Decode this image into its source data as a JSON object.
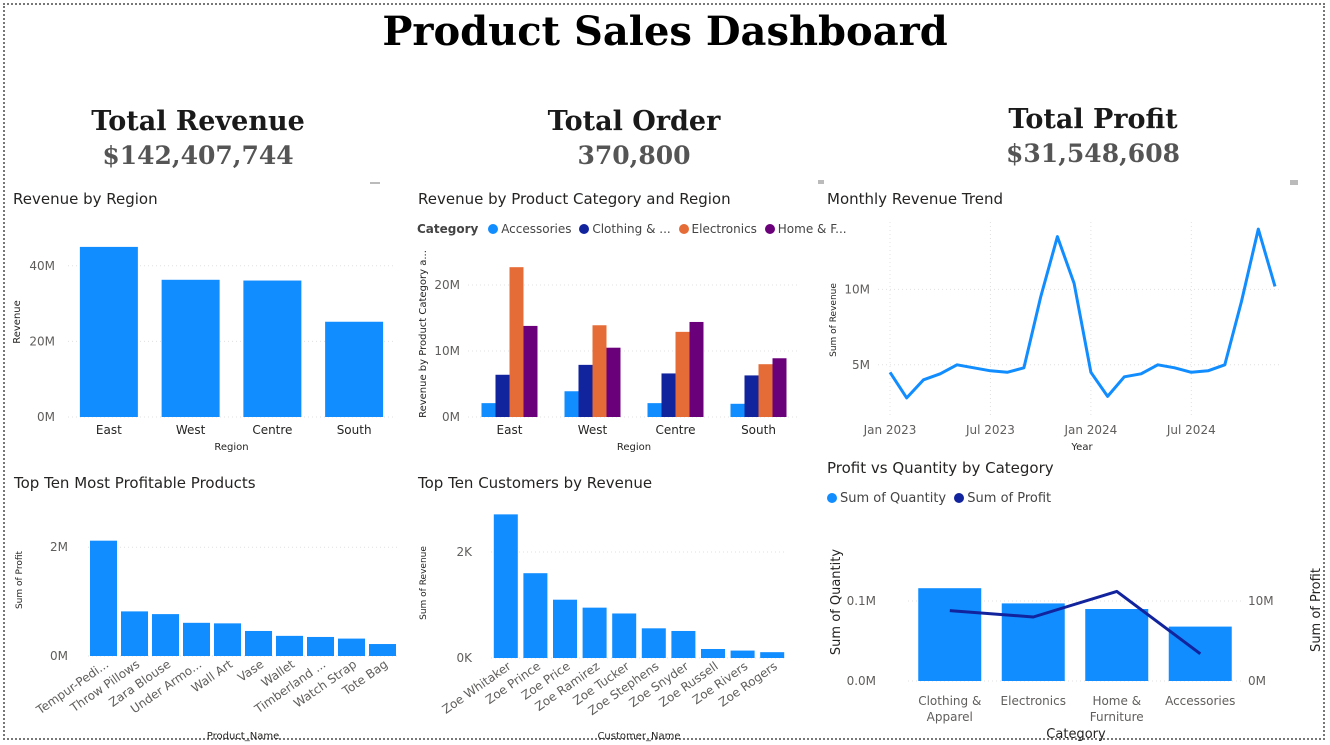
{
  "title": "Product Sales Dashboard",
  "kpis": {
    "revenue": {
      "label": "Total Revenue",
      "value": "$142,407,744"
    },
    "orders": {
      "label": "Total Order",
      "value": "370,800"
    },
    "profit": {
      "label": "Total Profit",
      "value": "$31,548,608"
    }
  },
  "colors": {
    "primary": "#118DFF",
    "navy": "#12239E",
    "orange": "#E66C37",
    "purple": "#6B007B",
    "grid": "#E0E0E0"
  },
  "charts": {
    "region": {
      "title": "Revenue by Region",
      "chart_data": {
        "type": "bar",
        "categories": [
          "East",
          "West",
          "Centre",
          "South"
        ],
        "values": [
          45,
          36.3,
          36.1,
          25.2
        ],
        "ylim": [
          0,
          50
        ],
        "yticks": [
          "0M",
          "20M",
          "40M"
        ],
        "ytick_values": [
          0,
          20,
          40
        ],
        "xlabel": "Region",
        "ylabel": "Revenue"
      }
    },
    "category_region": {
      "title": "Revenue by Product Category and Region",
      "legend_label": "Category",
      "legend_items": [
        "Accessories",
        "Clothing & ...",
        "Electronics",
        "Home & F..."
      ],
      "chart_data": {
        "type": "bar",
        "categories": [
          "East",
          "West",
          "Centre",
          "South"
        ],
        "series": [
          {
            "values": [
              2.1,
              3.9,
              2.1,
              2.0
            ]
          },
          {
            "values": [
              6.4,
              7.9,
              6.6,
              6.3
            ]
          },
          {
            "values": [
              22.7,
              13.9,
              12.9,
              8.0
            ]
          },
          {
            "values": [
              13.8,
              10.5,
              14.4,
              8.9
            ]
          }
        ],
        "ylim": [
          0,
          25
        ],
        "yticks": [
          "0M",
          "10M",
          "20M"
        ],
        "ytick_values": [
          0,
          10,
          20
        ],
        "xlabel": "Region",
        "ylabel": "Revenue by Product Category a..."
      }
    },
    "monthly": {
      "title": "Monthly Revenue Trend",
      "chart_data": {
        "type": "line",
        "x": [
          "2023-01",
          "2023-02",
          "2023-03",
          "2023-04",
          "2023-05",
          "2023-06",
          "2023-07",
          "2023-08",
          "2023-09",
          "2023-10",
          "2023-11",
          "2023-12",
          "2024-01",
          "2024-02",
          "2024-03",
          "2024-04",
          "2024-05",
          "2024-06",
          "2024-07",
          "2024-08",
          "2024-09",
          "2024-10",
          "2024-11",
          "2024-12"
        ],
        "values": [
          4.5,
          2.8,
          4.0,
          4.4,
          5.0,
          4.8,
          4.6,
          4.5,
          4.8,
          9.5,
          13.5,
          10.4,
          4.5,
          2.9,
          4.2,
          4.4,
          5.0,
          4.8,
          4.5,
          4.6,
          5.0,
          9.2,
          14.0,
          10.2
        ],
        "xticks": [
          "Jan 2023",
          "Jul 2023",
          "Jan 2024",
          "Jul 2024"
        ],
        "xtick_index": [
          0,
          6,
          12,
          18
        ],
        "ylim": [
          2,
          15
        ],
        "yticks": [
          "5M",
          "10M"
        ],
        "ytick_values": [
          5,
          10
        ],
        "xlabel": "Year",
        "ylabel": "Sum of Revenue"
      }
    },
    "products": {
      "title": "Top Ten Most Profitable Products",
      "chart_data": {
        "type": "bar",
        "categories": [
          "Tempur-Pedi...",
          "Throw Pillows",
          "Zara Blouse",
          "Under Armo...",
          "Wall Art",
          "Vase",
          "Wallet",
          "Timberland ...",
          "Watch Strap",
          "Tote Bag"
        ],
        "values": [
          2.12,
          0.82,
          0.77,
          0.61,
          0.6,
          0.46,
          0.37,
          0.35,
          0.32,
          0.22
        ],
        "ylim": [
          0,
          2.5
        ],
        "yticks": [
          "0M",
          "2M"
        ],
        "ytick_values": [
          0,
          2
        ],
        "xlabel": "Product_Name",
        "ylabel": "Sum of Profit"
      }
    },
    "customers": {
      "title": "Top Ten Customers by Revenue",
      "chart_data": {
        "type": "bar",
        "categories": [
          "Zoe Whitaker",
          "Zoe Prince",
          "Zoe Price",
          "Zoe Ramirez",
          "Zoe Tucker",
          "Zoe Stephens",
          "Zoe Snyder",
          "Zoe Russell",
          "Zoe Rivers",
          "Zoe Rogers"
        ],
        "values": [
          2710,
          1600,
          1100,
          950,
          840,
          560,
          510,
          170,
          140,
          110
        ],
        "ylim": [
          0,
          3000
        ],
        "yticks": [
          "0K",
          "2K"
        ],
        "ytick_values": [
          0,
          2000
        ],
        "xlabel": "Customer_Name",
        "ylabel": "Sum of Revenue"
      }
    },
    "profit_qty": {
      "title": "Profit vs Quantity by Category",
      "legend_items": [
        "Sum of Quantity",
        "Sum of Profit"
      ],
      "chart_data": {
        "type": "bar",
        "categories": [
          "Clothing & Apparel",
          "Electronics",
          "Home & Furniture",
          "Accessories"
        ],
        "category_lines": [
          [
            "Clothing &",
            "Apparel"
          ],
          [
            "Electronics"
          ],
          [
            "Home &",
            "Furniture"
          ],
          [
            "Accessories"
          ]
        ],
        "series": [
          {
            "name": "Sum of Quantity",
            "values": [
              0.116,
              0.097,
              0.09,
              0.068
            ],
            "ylim": [
              0,
              0.2
            ]
          },
          {
            "name": "Sum of Profit",
            "values": [
              8.8,
              8.0,
              11.2,
              3.4
            ],
            "ylim": [
              0,
              20
            ]
          }
        ],
        "yticks_left": [
          "0.0M",
          "0.1M"
        ],
        "yticks_left_values": [
          0,
          0.1
        ],
        "yticks_right": [
          "0M",
          "10M"
        ],
        "yticks_right_values": [
          0,
          10
        ],
        "xlabel": "Category",
        "ylabel_left": "Sum of Quantity",
        "ylabel_right": "Sum of Profit"
      }
    }
  }
}
